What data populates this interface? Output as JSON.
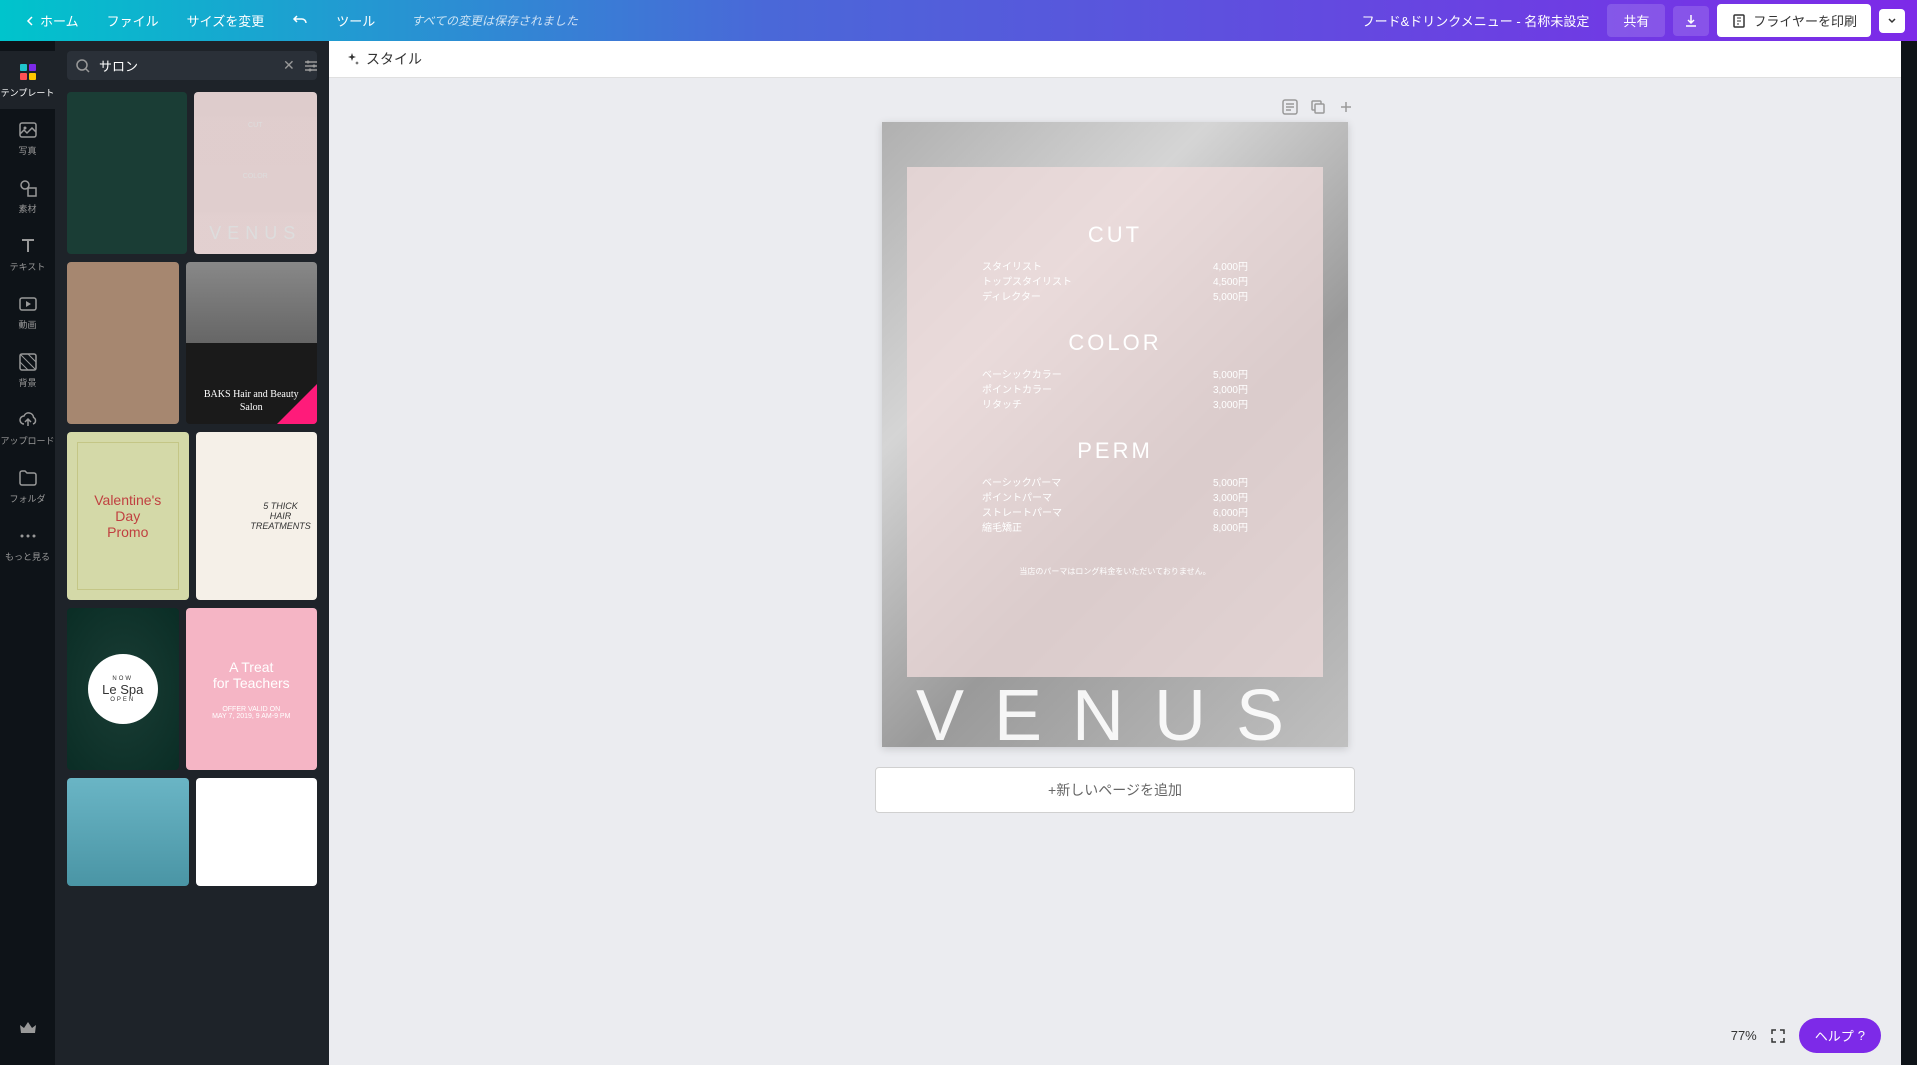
{
  "topbar": {
    "home": "ホーム",
    "file": "ファイル",
    "resize": "サイズを変更",
    "tools": "ツール",
    "status": "すべての変更は保存されました",
    "doc_title": "フード&ドリンクメニュー - 名称未設定",
    "share": "共有",
    "print": "フライヤーを印刷"
  },
  "sidebar": {
    "items": [
      {
        "label": "テンプレート"
      },
      {
        "label": "写真"
      },
      {
        "label": "素材"
      },
      {
        "label": "テキスト"
      },
      {
        "label": "動画"
      },
      {
        "label": "背景"
      },
      {
        "label": "アップロード"
      },
      {
        "label": "フォルダ"
      },
      {
        "label": "もっと見る"
      }
    ]
  },
  "panel": {
    "search_value": "サロン",
    "search_placeholder": "検索"
  },
  "templates": {
    "t1b_venus": "VENUS",
    "t1b_l1": "CUT",
    "t1b_l2": "COLOR",
    "t2b_title": "BAKS Hair and Beauty Salon",
    "t3a_line1": "Valentine's",
    "t3a_line2": "Day",
    "t3a_line3": "Promo",
    "t3b_line1": "5 THICK",
    "t3b_line2": "HAIR",
    "t3b_line3": "TREATMENTS",
    "t4a_now": "NOW",
    "t4a_name": "Le Spa",
    "t4a_open": "OPEN",
    "t4b_line1": "A Treat",
    "t4b_line2": "for Teachers",
    "t4b_sub1": "OFFER VALID ON",
    "t4b_sub2": "MAY 7, 2019, 9 AM-9 PM"
  },
  "context": {
    "style": "スタイル"
  },
  "design": {
    "sec1": {
      "title": "CUT",
      "rows": [
        {
          "name": "スタイリスト",
          "price": "4,000円"
        },
        {
          "name": "トップスタイリスト",
          "price": "4,500円"
        },
        {
          "name": "ディレクター",
          "price": "5,000円"
        }
      ]
    },
    "sec2": {
      "title": "COLOR",
      "rows": [
        {
          "name": "ベーシックカラー",
          "price": "5,000円"
        },
        {
          "name": "ポイントカラー",
          "price": "3,000円"
        },
        {
          "name": "リタッチ",
          "price": "3,000円"
        }
      ]
    },
    "sec3": {
      "title": "PERM",
      "rows": [
        {
          "name": "ベーシックパーマ",
          "price": "5,000円"
        },
        {
          "name": "ポイントパーマ",
          "price": "3,000円"
        },
        {
          "name": "ストレートパーマ",
          "price": "6,000円"
        },
        {
          "name": "縮毛矯正",
          "price": "8,000円"
        }
      ]
    },
    "note": "当店のパーマはロング料金をいただいておりません。",
    "brand": "VENUS"
  },
  "canvas": {
    "add_page": "+新しいページを追加",
    "zoom": "77%"
  },
  "help": {
    "label": "ヘルプ"
  }
}
